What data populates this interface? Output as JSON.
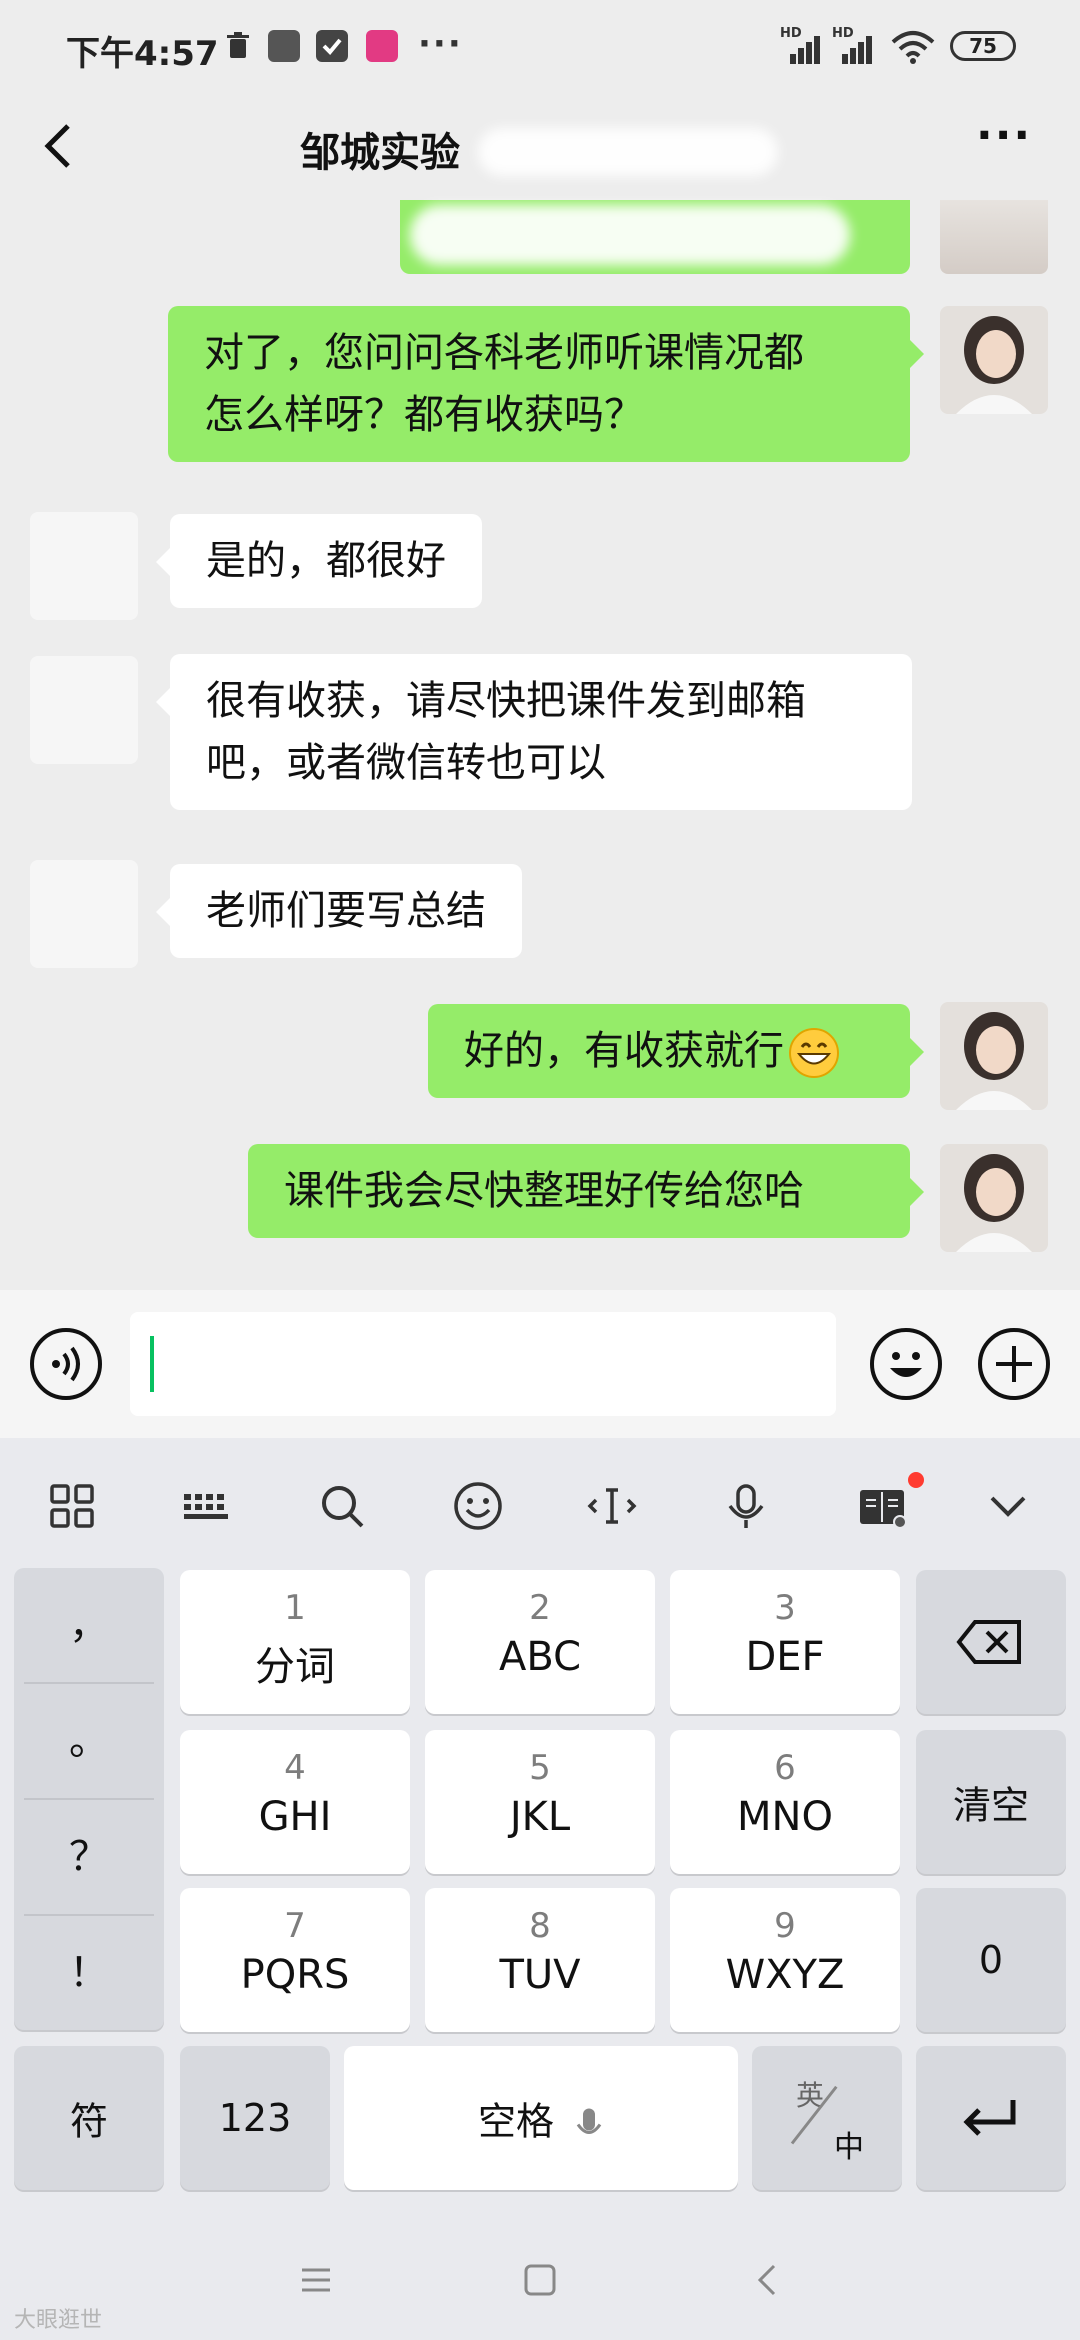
{
  "status_bar": {
    "time": "下午4:57",
    "more": "···",
    "signal_1": "HD",
    "signal_2": "HD",
    "battery": "75"
  },
  "header": {
    "title": "邹城实验",
    "more": "···",
    "back_icon": "chevron-left-icon"
  },
  "messages": [
    {
      "side": "me",
      "text_line_1": "对了，您问问各科老师听课情况都",
      "text_line_2": "怎么样呀？都有收获吗？"
    },
    {
      "side": "other",
      "text": "是的，都很好"
    },
    {
      "side": "other",
      "text_line_1": "很有收获，请尽快把课件发到邮箱",
      "text_line_2": "吧，或者微信转也可以"
    },
    {
      "side": "other",
      "text": "老师们要写总结"
    },
    {
      "side": "me",
      "text": "好的，有收获就行",
      "emoji": "grinning-face"
    },
    {
      "side": "me",
      "text": "课件我会尽快整理好传给您哈"
    }
  ],
  "input_bar": {
    "voice_icon": "voice-icon",
    "emoji_icon": "smiley-icon",
    "plus_icon": "plus-icon",
    "value": ""
  },
  "keyboard": {
    "toolbar_icons": [
      "grid-icon",
      "keyboard-icon",
      "search-icon",
      "smiley-icon",
      "cursor-icon",
      "microphone-icon",
      "book-icon",
      "chevron-down-icon"
    ],
    "symbols": [
      "，",
      "。",
      "？",
      "！"
    ],
    "keys": [
      {
        "num": "1",
        "label": "分词"
      },
      {
        "num": "2",
        "label": "ABC"
      },
      {
        "num": "3",
        "label": "DEF"
      },
      {
        "num": "4",
        "label": "GHI"
      },
      {
        "num": "5",
        "label": "JKL"
      },
      {
        "num": "6",
        "label": "MNO"
      },
      {
        "num": "7",
        "label": "PQRS"
      },
      {
        "num": "8",
        "label": "TUV"
      },
      {
        "num": "9",
        "label": "WXYZ"
      }
    ],
    "clear": "清空",
    "zero": "0",
    "fu": "符",
    "num_switch": "123",
    "space": "空格",
    "lang_top": "英",
    "lang_bottom": "中",
    "accent": "#95ec69",
    "notification_dot": "#ff3b30"
  },
  "watermark": "大眼逛世"
}
